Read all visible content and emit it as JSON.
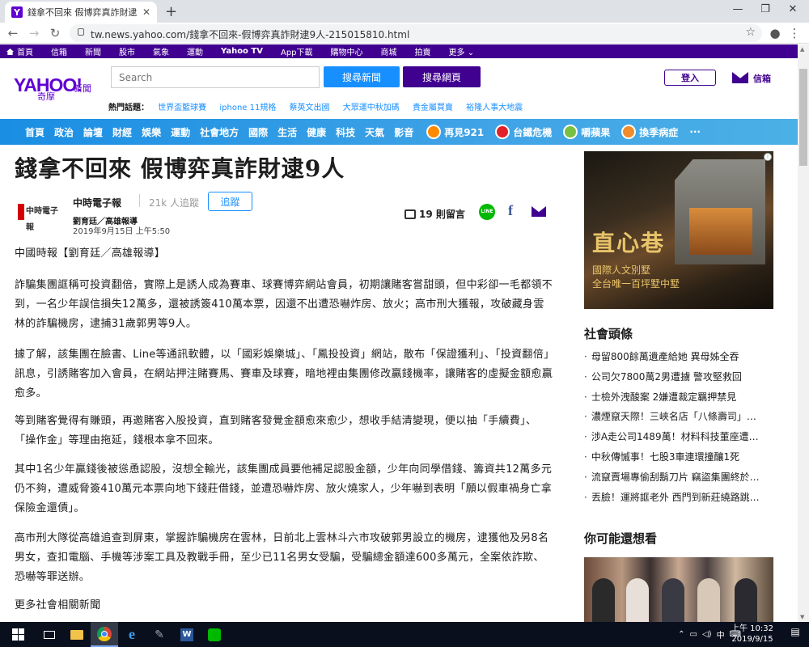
{
  "browser": {
    "tab_title": "錢拿不回來 假博弈真詐財逮9人 -",
    "url": "tw.news.yahoo.com/錢拿不回來-假博弈真詐財逮9人-215015810.html"
  },
  "topnav": [
    "首頁",
    "信箱",
    "新聞",
    "股市",
    "氣象",
    "運動",
    "Yahoo TV",
    "App下載",
    "購物中心",
    "商城",
    "拍賣",
    "更多"
  ],
  "header": {
    "logo": "YAHOO!",
    "logo_sub": "奇摩",
    "logo_news": "新聞",
    "search_placeholder": "Search",
    "btn_news": "搜尋新聞",
    "btn_web": "搜尋網頁",
    "login": "登入",
    "mail": "信箱"
  },
  "hot_topics": {
    "label": "熱門話題：",
    "items": [
      "世界盃籃球賽",
      "iphone 11規格",
      "蔡英文出國",
      "大眾運中秋加碼",
      "貴金屬買賣",
      "裕隆人事大地震"
    ]
  },
  "categories": [
    "首頁",
    "政治",
    "論壇",
    "財經",
    "娛樂",
    "運動",
    "社會地方",
    "國際",
    "生活",
    "健康",
    "科技",
    "天氣",
    "影音"
  ],
  "special_categories": [
    {
      "label": "再見921",
      "color": "#ff8a00"
    },
    {
      "label": "台鐵危機",
      "color": "#e0212b"
    },
    {
      "label": "嚼蘋果",
      "color": "#77c043"
    },
    {
      "label": "換季病症",
      "color": "#f08c2a"
    }
  ],
  "more": "···",
  "article": {
    "headline": "錢拿不回來 假博弈真詐財逮9人",
    "publisher_logo": "中時電子報",
    "publisher": "中時電子報",
    "followers": "21k 人追蹤",
    "follow": "追蹤",
    "author": "劉育廷／高雄報導",
    "date": "2019年9月15日 上午5:50",
    "comments": "19 則留言",
    "line": "LINE",
    "paragraphs": [
      "中國時報【劉育廷／高雄報導】",
      "詐騙集團誆稱可投資翻倍，實際上是誘人成為賽車、球賽博弈網站會員，初期讓賭客嘗甜頭，但中彩卻一毛都領不到，一名少年誤信損失12萬多，還被誘簽410萬本票，因還不出遭恐嚇炸房、放火；高市刑大獲報，攻破藏身雲林的詐騙機房，逮捕31歲郭男等9人。",
      "據了解，該集團在臉書、Line等通訊軟體，以「國彩娛樂城」、「鳳投投資」網站，散布「保證獲利」、「投資翻倍」訊息，引誘賭客加入會員，在網站押注賭賽馬、賽車及球賽，暗地裡由集團修改贏錢機率，讓賭客的虛擬金額愈贏愈多。",
      "等到賭客覺得有賺頭，再邀賭客入股投資，直到賭客發覺金額愈來愈少，想收手結清變現，便以抽「手續費」、「操作金」等理由拖延，錢根本拿不回來。",
      "其中1名少年贏錢後被慫恿認股，沒想全輸光，該集團成員要他補足認股金額，少年向同學借錢、籌資共12萬多元仍不夠，遭威脅簽410萬元本票向地下錢莊借錢，並遭恐嚇炸房、放火燒家人，少年嚇到表明「願以假車禍身亡拿保險金還債」。",
      "高市刑大隊從高雄追查到屏東，掌握詐騙機房在雲林，日前北上雲林斗六市攻破郭男設立的機房，逮獲他及另8名男女，查扣電腦、手機等涉案工具及教戰手冊，至少已11名男女受騙，受騙總金額達600多萬元，全案依詐欺、恐嚇等罪送辦。",
      "更多社會相關新聞"
    ]
  },
  "ad": {
    "title": "直心巷",
    "line1": "國際人文別墅",
    "line2": "全台唯一百坪墅中墅",
    "info": "i"
  },
  "sidebar": {
    "society_title": "社會頭條",
    "society": [
      "母留800餘萬遺產給她 異母姊全吞",
      "公司欠7800萬2男遭擄 警攻堅救回",
      "士檢外洩酸案 2嫌遭裁定羈押禁見",
      "濃煙竄天際！三峽名店「八條壽司」…",
      "涉A走公司1489萬！材料科技董座遭…",
      "中秋傳慽事！七股3車連環撞釀1死",
      "流竄賣場專偷刮鬍刀片 竊盜集團終於…",
      "丟臉！運將誆老外 西門到新莊繞路跳…"
    ],
    "maybe_title": "你可能還想看"
  },
  "taskbar": {
    "time": "上午 10:32",
    "date": "2019/9/15",
    "ime": "中"
  },
  "colors": {
    "yahoo_purple": "#400090",
    "yahoo_blue": "#188fff",
    "category_bar": "#1a8ee3"
  }
}
